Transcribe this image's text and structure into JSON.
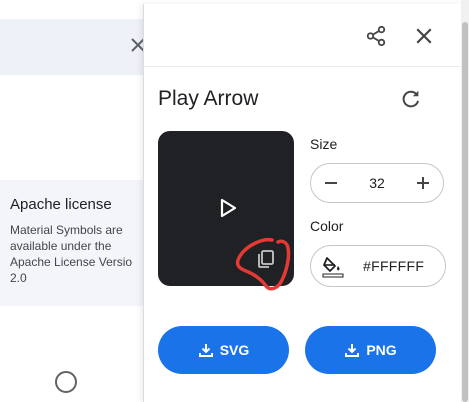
{
  "background": {
    "license_title": "Apache license",
    "license_lines": [
      "Material Symbols are",
      "available under the",
      "Apache License Versio",
      "2.0"
    ]
  },
  "panel": {
    "title": "Play Arrow",
    "size_label": "Size",
    "size_value": "32",
    "color_label": "Color",
    "color_value": "#FFFFFF",
    "svg_button": "SVG",
    "png_button": "PNG"
  },
  "icons": {
    "share": "share-icon",
    "close": "close-icon",
    "refresh": "refresh-icon",
    "preview": "play-arrow-icon",
    "copy": "copy-icon",
    "minus": "minus-icon",
    "plus": "plus-icon",
    "fill": "format-color-fill-icon",
    "download": "download-icon"
  },
  "colors": {
    "accent": "#1a73e8",
    "preview_bg": "#202124",
    "annotation": "#e53935"
  }
}
